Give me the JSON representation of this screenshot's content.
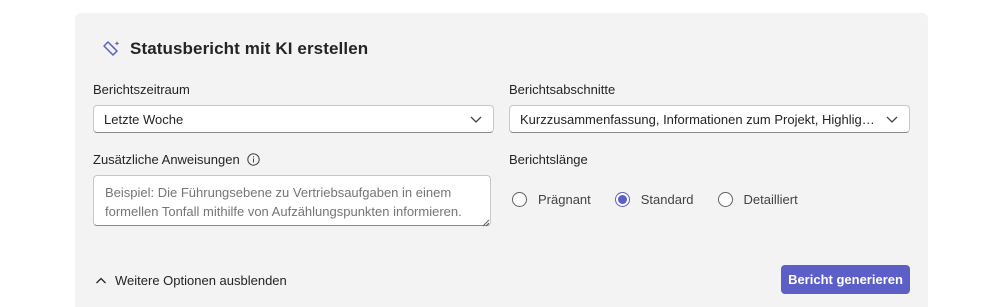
{
  "header": {
    "title": "Statusbericht mit KI erstellen",
    "icon": "ai-sparkle-icon"
  },
  "period": {
    "label": "Berichtszeitraum",
    "value": "Letzte Woche"
  },
  "sections": {
    "label": "Berichtsabschnitte",
    "value": "Kurzzusammenfassung, Informationen zum Projekt, Highlights..."
  },
  "instructions": {
    "label": "Zusätzliche Anweisungen",
    "placeholder": "Beispiel: Die Führungsebene zu Vertriebsaufgaben in einem formellen Tonfall mithilfe von Aufzählungspunkten informieren."
  },
  "length": {
    "label": "Berichtslänge",
    "options": [
      {
        "label": "Prägnant",
        "selected": false
      },
      {
        "label": "Standard",
        "selected": true
      },
      {
        "label": "Detailliert",
        "selected": false
      }
    ]
  },
  "footer": {
    "toggle_label": "Weitere Optionen ausblenden",
    "generate_label": "Bericht generieren"
  },
  "colors": {
    "accent": "#5b5fc7",
    "panel": "#f3f3f3"
  }
}
